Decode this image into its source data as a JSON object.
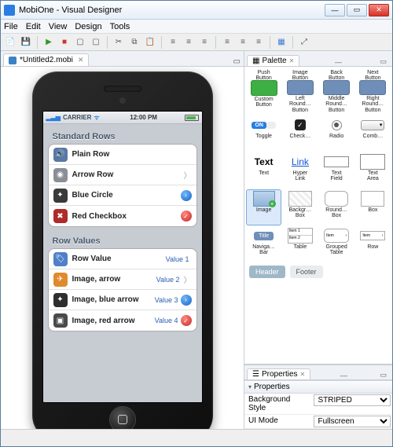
{
  "window": {
    "title": "MobiOne - Visual Designer"
  },
  "menu": [
    "File",
    "Edit",
    "View",
    "Design",
    "Tools"
  ],
  "tab": {
    "label": "*Untitled2.mobi"
  },
  "phone": {
    "carrier": "CARRIER",
    "time": "12:00 PM",
    "group1_header": "Standard Rows",
    "group1_rows": [
      {
        "label": "Plain Row",
        "icon_bg": "#5a78a5"
      },
      {
        "label": "Arrow Row",
        "icon_bg": "#8a8f95"
      },
      {
        "label": "Blue Circle",
        "icon_bg": "#3a3a3a"
      },
      {
        "label": "Red Checkbox",
        "icon_bg": "#b02a2a"
      }
    ],
    "group2_header": "Row Values",
    "group2_rows": [
      {
        "label": "Row Value",
        "value": "Value 1",
        "icon_bg": "#5080c8"
      },
      {
        "label": "Image, arrow",
        "value": "Value 2",
        "icon_bg": "#e08a2e"
      },
      {
        "label": "Image, blue arrow",
        "value": "Value 3",
        "icon_bg": "#2e2e2e"
      },
      {
        "label": "Image, red arrow",
        "value": "Value 4",
        "icon_bg": "#4a4a4a"
      }
    ]
  },
  "palette": {
    "title": "Palette",
    "items_row0": [
      "Push\nButton",
      "Image\nButton",
      "Back\nButton",
      "Next\nButton"
    ],
    "items": [
      {
        "label": "Custom\nButton",
        "bg": "#3cb043"
      },
      {
        "label": "Left\nRound…\nButton",
        "bg": "#6f8fb8"
      },
      {
        "label": "Middle\nRound…\nButton",
        "bg": "#6f8fb8"
      },
      {
        "label": "Right\nRound…\nButton",
        "bg": "#6f8fb8"
      },
      {
        "label": "Toggle",
        "swatch": "toggle"
      },
      {
        "label": "Check…",
        "swatch": "check"
      },
      {
        "label": "Radio",
        "swatch": "radio"
      },
      {
        "label": "Comb…",
        "swatch": "combo"
      },
      {
        "label": "Text",
        "swatch": "text"
      },
      {
        "label": "Hyper\nLink",
        "swatch": "link"
      },
      {
        "label": "Text\nField",
        "swatch": "fieldbox"
      },
      {
        "label": "Text\nArea",
        "swatch": "areabox"
      },
      {
        "label": "Image",
        "swatch": "img",
        "selected": true
      },
      {
        "label": "Backgr…\nBox",
        "swatch": "bgbox"
      },
      {
        "label": "Round…\nBox",
        "swatch": "rbox"
      },
      {
        "label": "Box",
        "swatch": "box"
      },
      {
        "label": "Naviga…\nBar",
        "swatch": "nav"
      },
      {
        "label": "Table",
        "swatch": "table"
      },
      {
        "label": "Grouped\nTable",
        "swatch": "gtable"
      },
      {
        "label": "Row",
        "swatch": "row"
      }
    ],
    "header_btn": "Header",
    "footer_btn": "Footer"
  },
  "properties": {
    "title": "Properties",
    "group": "Properties",
    "rows": [
      {
        "key": "Background Style",
        "value": "STRIPED"
      },
      {
        "key": "UI Mode",
        "value": "Fullscreen"
      }
    ]
  }
}
